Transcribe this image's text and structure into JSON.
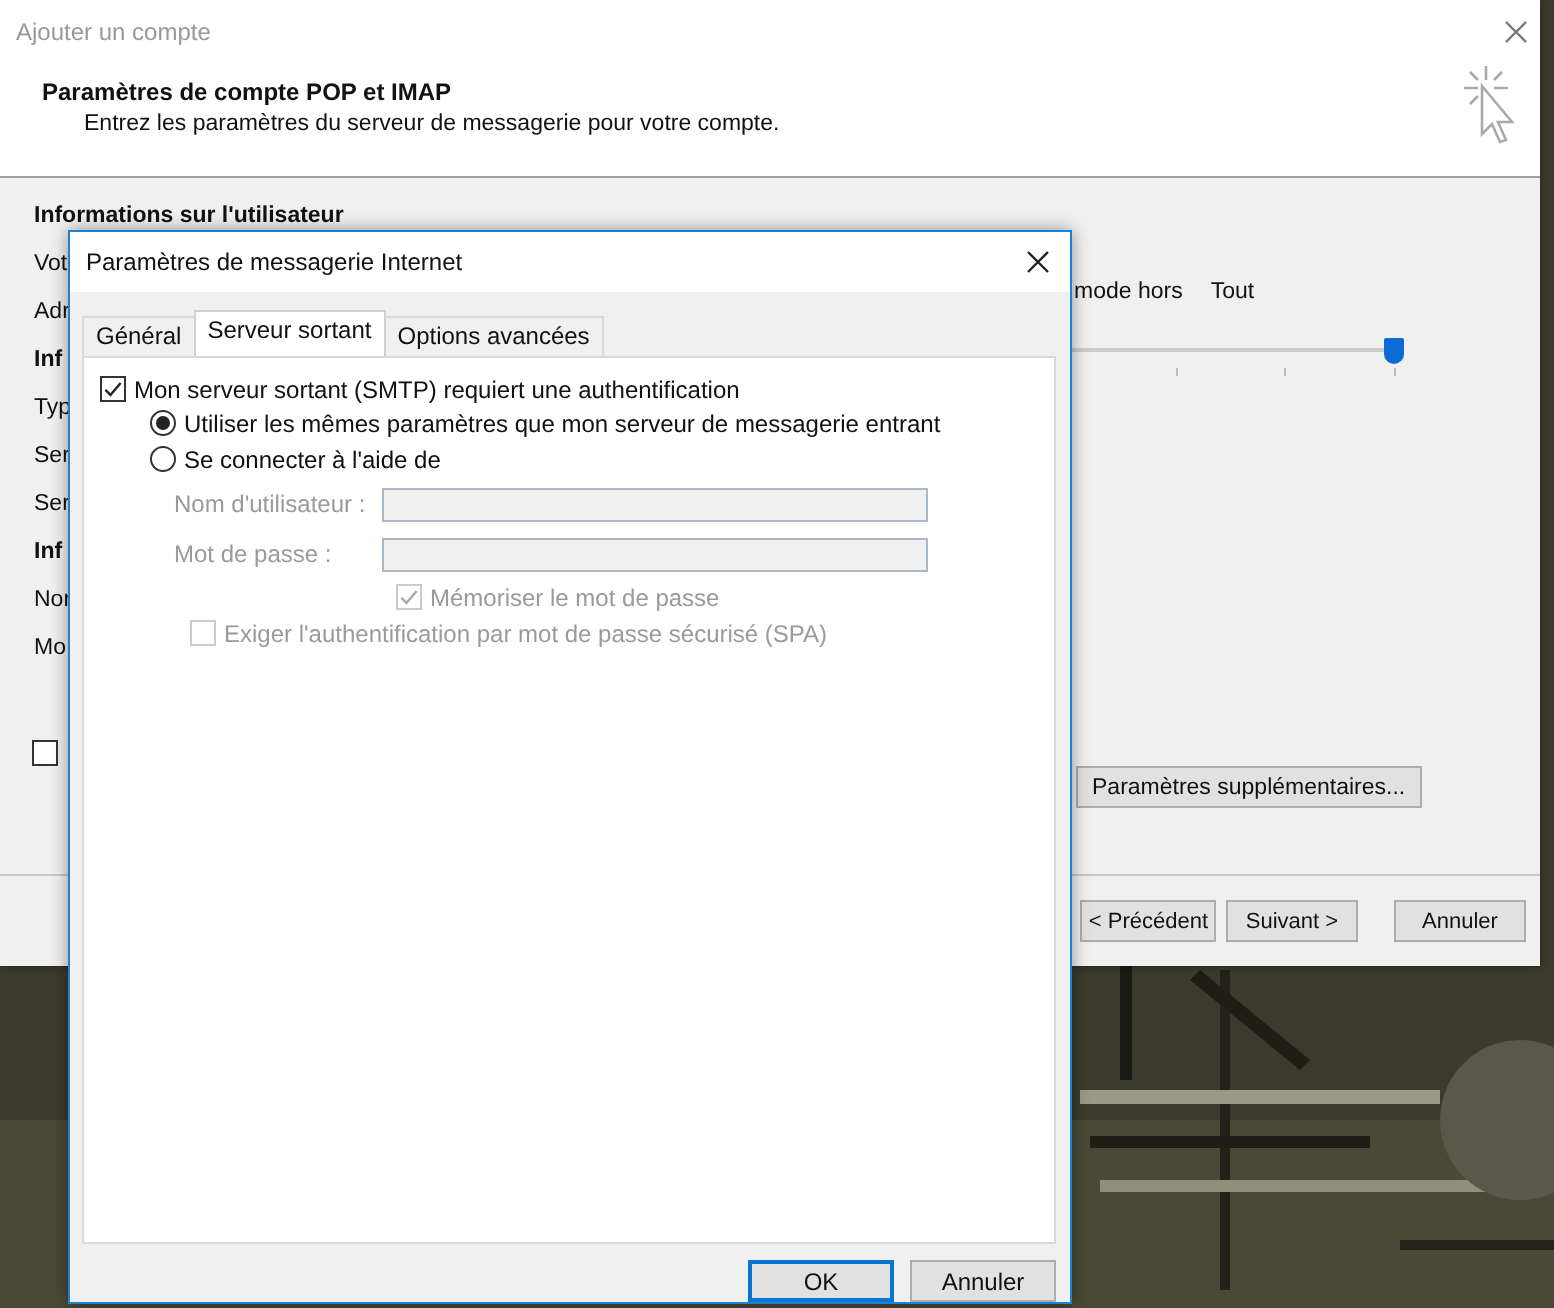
{
  "window": {
    "title": "Ajouter un compte",
    "heading": "Paramètres de compte POP et IMAP",
    "subheading": "Entrez les paramètres du serveur de messagerie pour votre compte.",
    "form_labels": [
      {
        "text": "Informations sur l'utilisateur",
        "kind": "section"
      },
      {
        "text": "Vot",
        "kind": "field"
      },
      {
        "text": "Adr",
        "kind": "field"
      },
      {
        "text": "Inf",
        "kind": "section"
      },
      {
        "text": "Typ",
        "kind": "field"
      },
      {
        "text": "Ser",
        "kind": "field"
      },
      {
        "text": "Ser",
        "kind": "field"
      },
      {
        "text": "Inf",
        "kind": "section"
      },
      {
        "text": "Nor",
        "kind": "field"
      },
      {
        "text": "Mo",
        "kind": "field"
      }
    ],
    "checkbox": {
      "checked": false
    },
    "offline_labels": [
      "mode hors",
      "Tout"
    ],
    "slider": {
      "level": 1
    },
    "more_settings_button": "Paramètres supplémentaires...",
    "buttons": [
      "< Précédent",
      "Suivant >",
      "Annuler"
    ]
  },
  "dialog": {
    "title": "Paramètres de messagerie Internet",
    "tabs": [
      {
        "label": "Général",
        "selected": false
      },
      {
        "label": "Serveur sortant",
        "selected": true
      },
      {
        "label": "Options avancées",
        "selected": false
      }
    ],
    "auth_checkbox": {
      "label": "Mon serveur sortant (SMTP) requiert une authentification",
      "checked": true
    },
    "auth_options": [
      {
        "label": "Utiliser les mêmes paramètres que mon serveur de messagerie entrant",
        "selected": true
      },
      {
        "label": "Se connecter à l'aide de",
        "selected": false
      }
    ],
    "fields": [
      {
        "label": "Nom d'utilisateur :",
        "disabled": true
      },
      {
        "label": "Mot de passe :",
        "disabled": true
      }
    ],
    "remember_password": {
      "label": "Mémoriser le mot de passe",
      "checked": true,
      "disabled": true
    },
    "spa": {
      "label": "Exiger l'authentification par mot de passe sécurisé (SPA)",
      "checked": false,
      "disabled": true
    },
    "buttons": [
      {
        "label": "OK",
        "default": true
      },
      {
        "label": "Annuler",
        "default": false
      }
    ]
  }
}
